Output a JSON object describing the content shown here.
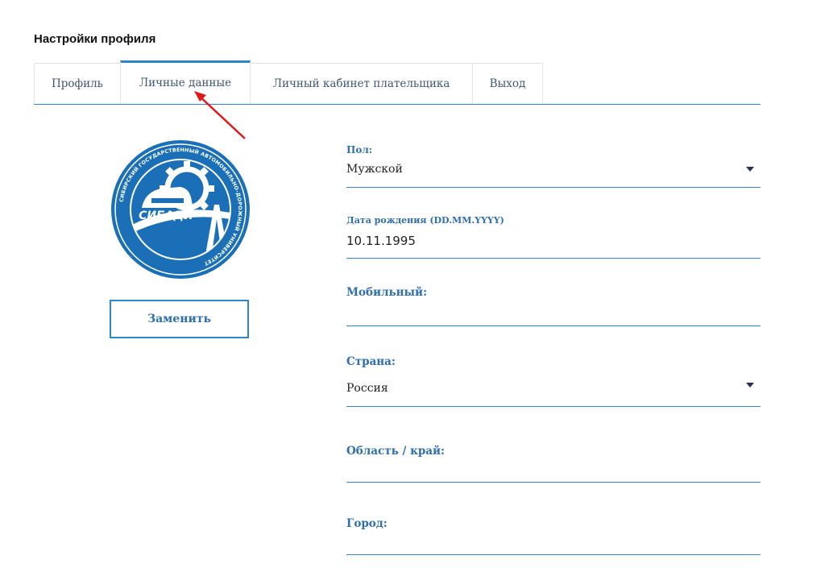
{
  "page": {
    "title": "Настройки профиля"
  },
  "tabs": [
    {
      "label": "Профиль",
      "active": false
    },
    {
      "label": "Личные данные",
      "active": true
    },
    {
      "label": "Личный кабинет плательщика",
      "active": false
    },
    {
      "label": "Выход",
      "active": false
    }
  ],
  "avatar": {
    "logo_text": "СИБАДИ",
    "ring_text": "СИБИРСКИЙ ГОСУДАРСТВЕННЫЙ АВТОМОБИЛЬНО-ДОРОЖНЫЙ УНИВЕРСИТЕТ",
    "replace_label": "Заменить"
  },
  "form": {
    "gender": {
      "label": "Пол:",
      "value": "Мужской"
    },
    "dob": {
      "label": "Дата рождения (DD.MM.YYYY)",
      "value": "10.11.1995"
    },
    "mobile": {
      "label": "Мобильный:",
      "value": ""
    },
    "country": {
      "label": "Страна:",
      "value": "Россия"
    },
    "region": {
      "label": "Область / край:",
      "value": ""
    },
    "city": {
      "label": "Город:",
      "value": ""
    }
  },
  "colors": {
    "accent": "#2f86c7",
    "label": "#2f6fae",
    "logo_blue": "#1a6fb6",
    "arrow": "#e0191b"
  },
  "icons": {
    "dropdown": "caret-down-icon",
    "annotation": "red-arrow-annotation"
  }
}
